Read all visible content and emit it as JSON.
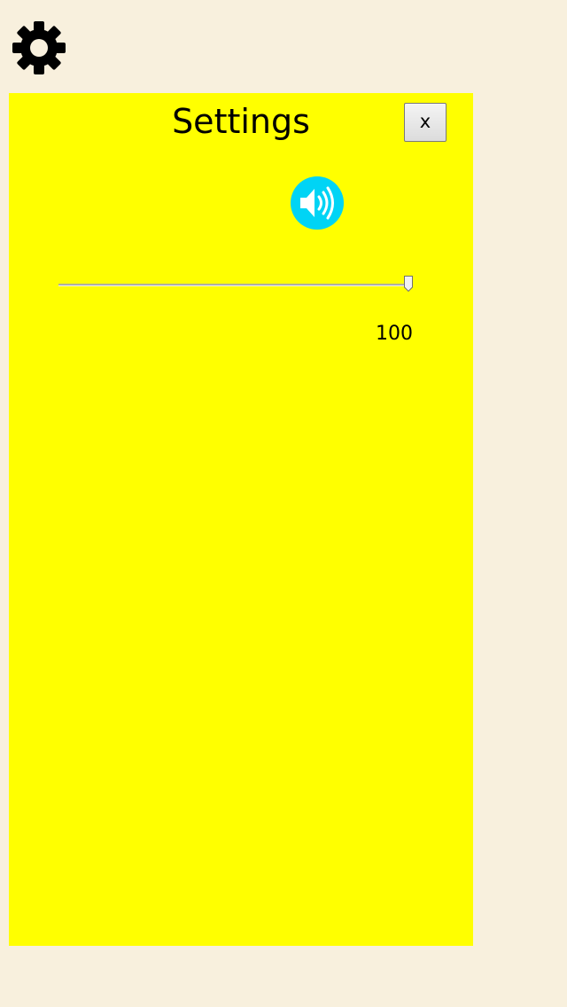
{
  "settings_panel": {
    "title": "Settings",
    "close_label": "x",
    "sound_icon": "speaker-icon",
    "volume": {
      "value": 100,
      "min": 0,
      "max": 100,
      "display": "100"
    }
  },
  "settings_icon": "gear-icon",
  "colors": {
    "page_background": "#f8f0dd",
    "panel_background": "#ffff00",
    "sound_button": "#00d4f5"
  }
}
